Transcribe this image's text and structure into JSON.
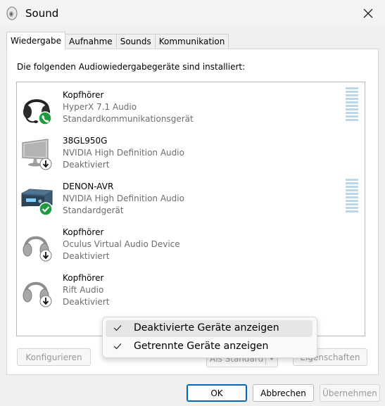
{
  "window": {
    "title": "Sound",
    "icon": "speaker-icon",
    "close_icon": "close-icon"
  },
  "tabs": [
    {
      "label": "Wiedergabe",
      "active": true
    },
    {
      "label": "Aufnahme"
    },
    {
      "label": "Sounds"
    },
    {
      "label": "Kommunikation"
    }
  ],
  "intro": "Die folgenden Audiowiedergabegeräte sind installiert:",
  "devices": [
    {
      "name": "Kopfhörer",
      "driver": "HyperX 7.1 Audio",
      "status": "Standardkommunikationsgerät",
      "icon": "headset-icon",
      "badge": "phone-badge"
    },
    {
      "name": "38GL950G",
      "driver": "NVIDIA High Definition Audio",
      "status": "Deaktiviert",
      "icon": "monitor-icon",
      "badge": "disabled-badge"
    },
    {
      "name": "DENON-AVR",
      "driver": "NVIDIA High Definition Audio",
      "status": "Standardgerät",
      "icon": "receiver-icon",
      "badge": "check-badge"
    },
    {
      "name": "Kopfhörer",
      "driver": "Oculus Virtual Audio Device",
      "status": "Deaktiviert",
      "icon": "headphones-icon",
      "badge": "disabled-badge"
    },
    {
      "name": "Kopfhörer",
      "driver": "Rift Audio",
      "status": "Deaktiviert",
      "icon": "headphones-icon",
      "badge": "disabled-badge"
    }
  ],
  "buttons": {
    "configure": "Konfigurieren",
    "set_default": "Als Standard",
    "properties": "Eigenschaften",
    "ok": "OK",
    "cancel": "Abbrechen",
    "apply": "Übernehmen"
  },
  "context_menu": [
    {
      "label": "Deaktivierte Geräte anzeigen",
      "checked": true
    },
    {
      "label": "Getrennte Geräte anzeigen",
      "checked": true
    }
  ],
  "colors": {
    "accent": "#0067c0",
    "check_green": "#1e9b3e",
    "level_meter": "#bcd7e7"
  }
}
